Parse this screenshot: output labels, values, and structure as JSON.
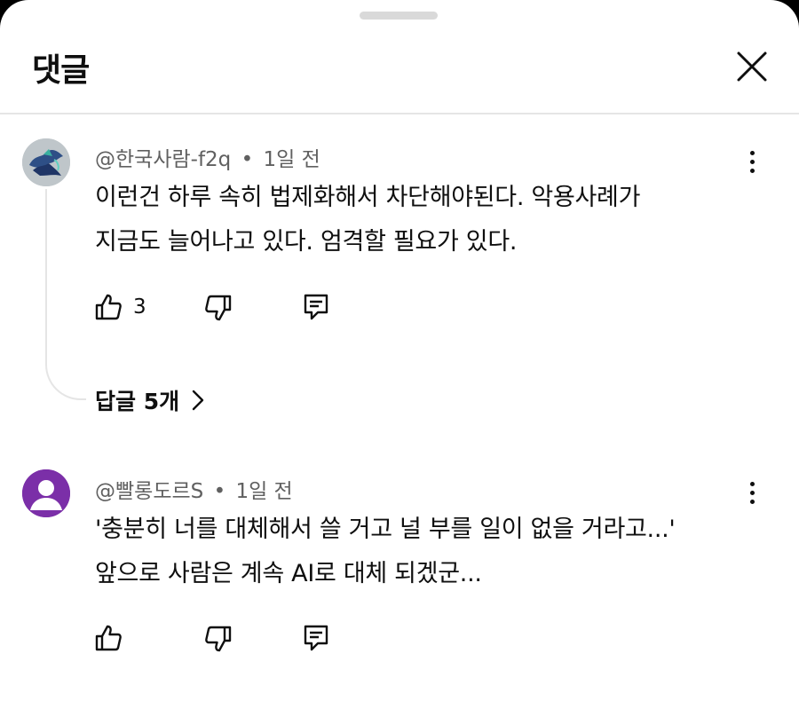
{
  "header": {
    "title": "댓글"
  },
  "comments": [
    {
      "author": "@한국사람-f2q",
      "sep": "•",
      "time": "1일 전",
      "lines": [
        "이런건 하루 속히 법제화해서 차단해야된다. 악용사례가",
        "지금도 늘어나고 있다. 엄격할 필요가 있다."
      ],
      "likes": "3",
      "replies_label": "답글 5개"
    },
    {
      "author": "@빨롱도르S",
      "sep": "•",
      "time": "1일 전",
      "lines": [
        "'충분히 너를 대체해서 쓸 거고 널 부를 일이 없을 거라고...'",
        "앞으로 사람은 계속 AI로 대체 되겠군..."
      ],
      "likes": ""
    }
  ],
  "icons": [
    "close-icon",
    "more-vert-icon",
    "thumbs-up-icon",
    "thumbs-down-icon",
    "reply-icon",
    "chevron-right-icon"
  ],
  "colors": {
    "avatar2": "#7b2fa8",
    "meta": "#606060",
    "text": "#0f0f0f"
  }
}
